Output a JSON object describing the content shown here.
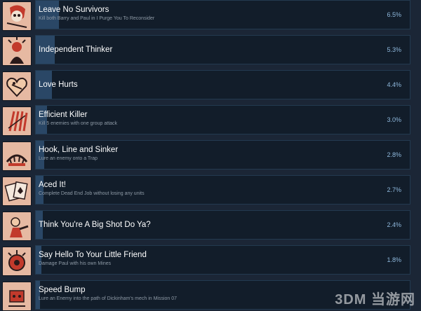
{
  "accent_color": "#2a4766",
  "achievements": [
    {
      "title": "Leave No Survivors",
      "description": "Kill both Barry and Paul in I Purge You To Reconsider",
      "percent": "6.5%",
      "icon": "skull-bandana-icon",
      "fill_fraction": 0.065
    },
    {
      "title": "Independent Thinker",
      "description": "",
      "percent": "5.3%",
      "icon": "exploding-head-icon",
      "fill_fraction": 0.053
    },
    {
      "title": "Love Hurts",
      "description": "",
      "percent": "4.4%",
      "icon": "bandaged-heart-icon",
      "fill_fraction": 0.044
    },
    {
      "title": "Efficient Killer",
      "description": "Kill 5 enemies with one group attack",
      "percent": "3.0%",
      "icon": "claw-marks-icon",
      "fill_fraction": 0.03
    },
    {
      "title": "Hook, Line and Sinker",
      "description": "Lure an enemy onto a Trap",
      "percent": "2.8%",
      "icon": "bear-trap-icon",
      "fill_fraction": 0.028
    },
    {
      "title": "Aced It!",
      "description": "Complete Dead End Job without losing any units",
      "percent": "2.7%",
      "icon": "playing-cards-icon",
      "fill_fraction": 0.027
    },
    {
      "title": "Think You're A Big Shot Do Ya?",
      "description": "",
      "percent": "2.4%",
      "icon": "gunslinger-icon",
      "fill_fraction": 0.024
    },
    {
      "title": "Say Hello To Your Little Friend",
      "description": "Damage Paul with his own Mines",
      "percent": "1.8%",
      "icon": "landmine-icon",
      "fill_fraction": 0.018
    },
    {
      "title": "Speed Bump",
      "description": "Lure an Enemy into the path of Dickinham's mech in Mission 07",
      "percent": "",
      "icon": "crashed-robot-icon",
      "fill_fraction": 0.012
    }
  ],
  "watermark": "3DM 当游网"
}
